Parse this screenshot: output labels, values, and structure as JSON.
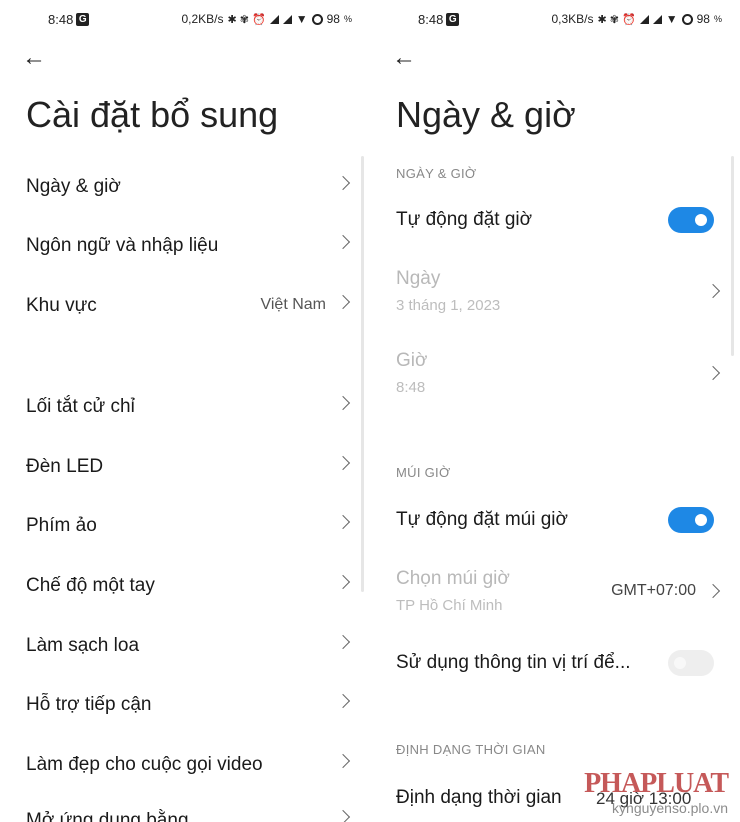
{
  "left": {
    "status": {
      "time": "8:48",
      "badge": "G",
      "speed": "0,2KB/s",
      "icons": "✱ ✾ ⏰",
      "battery": "98"
    },
    "title": "Cài đặt bổ sung",
    "items": [
      {
        "label": "Ngày & giờ"
      },
      {
        "label": "Ngôn ngữ và nhập liệu"
      },
      {
        "label": "Khu vực",
        "value": "Việt Nam"
      },
      {
        "label": "Lối tắt cử chỉ"
      },
      {
        "label": "Đèn LED"
      },
      {
        "label": "Phím ảo"
      },
      {
        "label": "Chế độ một tay"
      },
      {
        "label": "Làm sạch loa"
      },
      {
        "label": "Hỗ trợ tiếp cận"
      },
      {
        "label": "Làm đẹp cho cuộc gọi video"
      },
      {
        "label": "Mở ứng dụng bằng..."
      }
    ]
  },
  "right": {
    "status": {
      "time": "8:48",
      "badge": "G",
      "speed": "0,3KB/s",
      "icons": "✱ ✾ ⏰",
      "battery": "98"
    },
    "title": "Ngày & giờ",
    "sections": {
      "date_time": "NGÀY & GIỜ",
      "timezone": "MÚI GIỜ",
      "time_format": "ĐỊNH DẠNG THỜI GIAN"
    },
    "auto_time": {
      "label": "Tự động đặt giờ",
      "on": true
    },
    "date": {
      "label": "Ngày",
      "value": "3 tháng 1, 2023"
    },
    "time": {
      "label": "Giờ",
      "value": "8:48"
    },
    "auto_timezone": {
      "label": "Tự động đặt múi giờ",
      "on": true
    },
    "choose_timezone": {
      "label": "Chọn múi giờ",
      "city": "TP Hồ Chí Minh",
      "value": "GMT+07:00"
    },
    "use_location": {
      "label": "Sử dụng thông tin vị trí để...",
      "on": false
    },
    "time_format": {
      "label": "Định dạng thời gian",
      "value": "24 giờ 13:00"
    }
  },
  "watermark": {
    "logo": "PHAPLUAT",
    "site": "kynguyenso.plo.vn"
  },
  "colors": {
    "accent": "#1e88e5",
    "watermark": "#b22222"
  }
}
